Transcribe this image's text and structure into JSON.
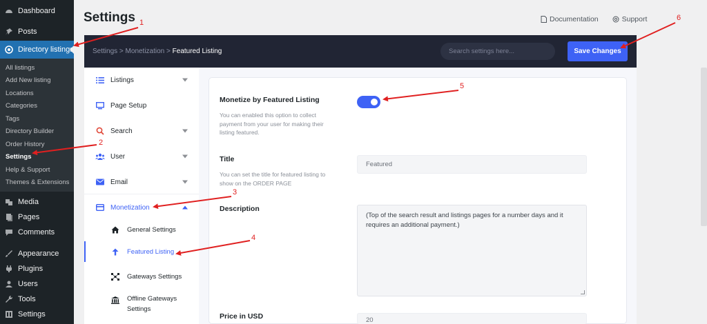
{
  "wp_menu": {
    "dashboard": "Dashboard",
    "posts": "Posts",
    "directory": "Directory listings",
    "submenu": [
      "All listings",
      "Add New listing",
      "Locations",
      "Categories",
      "Tags",
      "Directory Builder",
      "Order History",
      "Settings",
      "Help & Support",
      "Themes & Extensions"
    ],
    "media": "Media",
    "pages": "Pages",
    "comments": "Comments",
    "appearance": "Appearance",
    "plugins": "Plugins",
    "users": "Users",
    "tools": "Tools",
    "settings": "Settings"
  },
  "header": {
    "title": "Settings",
    "documentation": "Documentation",
    "support": "Support"
  },
  "topbar": {
    "crumb1": "Settings",
    "crumb2": "Monetization",
    "crumb3": "Featured Listing",
    "search_placeholder": "Search settings here...",
    "save_label": "Save Changes"
  },
  "settings_nav": {
    "listings": "Listings",
    "page_setup": "Page Setup",
    "search": "Search",
    "user": "User",
    "email": "Email",
    "monetization": "Monetization",
    "general_settings": "General Settings",
    "featured_listing": "Featured Listing",
    "gateways_settings": "Gateways Settings",
    "offline_line1": "Offline Gateways",
    "offline_line2": "Settings"
  },
  "form": {
    "monetize_label": "Monetize by Featured Listing",
    "monetize_desc": "You can enabled this option to collect payment from your user for making their listing featured.",
    "monetize_enabled": true,
    "title_label": "Title",
    "title_desc": "You can set the title for featured listing to show on the ORDER PAGE",
    "title_value": "Featured",
    "description_label": "Description",
    "description_value": "(Top of the search result and listings pages for a number days and it requires an additional payment.)",
    "price_label": "Price in USD",
    "price_value": "20"
  },
  "annotations": [
    "1",
    "2",
    "3",
    "4",
    "5",
    "6"
  ],
  "colors": {
    "accent": "#3e62f5",
    "wp_sidebar": "#1d2327",
    "wp_active": "#2271b1",
    "topbar": "#212534",
    "annotation": "#e02020"
  }
}
